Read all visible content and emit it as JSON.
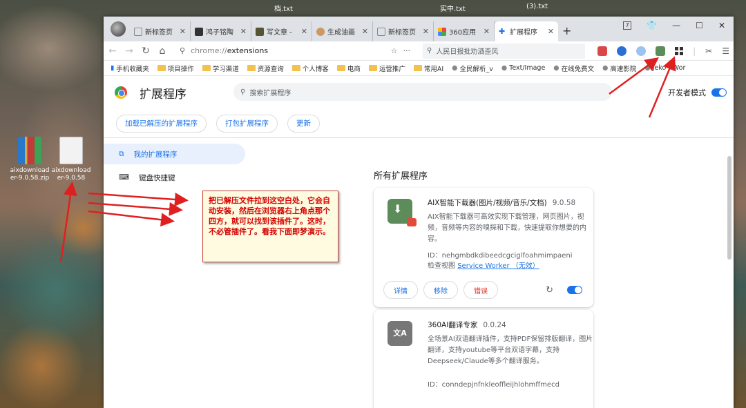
{
  "desktop": {
    "top_texts": [
      "档.txt",
      "实中.txt",
      "(3).txt"
    ],
    "icons": [
      {
        "label": "aixdownload er-9.0.58.zip"
      },
      {
        "label": "aixdownload er-9.0.58"
      }
    ]
  },
  "window": {
    "tabs": [
      {
        "title": "新标签页",
        "favicon": "page-icon"
      },
      {
        "title": "鸿子铭陶",
        "favicon": "photo-icon"
      },
      {
        "title": "写文章 -",
        "favicon": "photo-icon"
      },
      {
        "title": "生成油画",
        "favicon": "portrait-icon"
      },
      {
        "title": "新标签页",
        "favicon": "page-icon"
      },
      {
        "title": "360应用",
        "favicon": "apps-icon"
      },
      {
        "title": "扩展程序",
        "favicon": "puzzle-icon",
        "active": true
      }
    ],
    "new_tab": "+",
    "controls": {
      "badge": "7",
      "minimize": "—",
      "maximize": "☐",
      "close": "✕"
    }
  },
  "toolbar": {
    "url_scheme": "chrome://",
    "url_path": "extensions",
    "search_placeholder": "人民日报批劝酒歪风"
  },
  "bookmarks": [
    {
      "label": "手机收藏夹",
      "type": "mobile"
    },
    {
      "label": "项目操作",
      "type": "folder"
    },
    {
      "label": "学习渠道",
      "type": "folder"
    },
    {
      "label": "资源查询",
      "type": "folder"
    },
    {
      "label": "个人博客",
      "type": "folder"
    },
    {
      "label": "电商",
      "type": "folder"
    },
    {
      "label": "运营推广",
      "type": "folder"
    },
    {
      "label": "常用AI",
      "type": "folder"
    },
    {
      "label": "全民解析_v",
      "type": "site"
    },
    {
      "label": "Text/Image",
      "type": "site"
    },
    {
      "label": "在线免费文",
      "type": "site"
    },
    {
      "label": "高速影院",
      "type": "site"
    },
    {
      "label": "Jeko - Wor",
      "type": "site"
    }
  ],
  "extensions_page": {
    "title": "扩展程序",
    "search_placeholder": "搜索扩展程序",
    "dev_mode_label": "开发者模式",
    "dev_mode_on": true,
    "buttons": {
      "load_unpacked": "加载已解压的扩展程序",
      "pack": "打包扩展程序",
      "update": "更新"
    },
    "sidebar": [
      {
        "label": "我的扩展程序",
        "active": true
      },
      {
        "label": "键盘快捷键",
        "active": false
      }
    ],
    "all_title": "所有扩展程序",
    "cards": [
      {
        "name": "AIX智能下载器(图片/视频/音乐/文档)",
        "version": "9.0.58",
        "desc": "AIX智能下载器可高效实现下载管理，网页图片，视频，音频等内容的嗅探和下载，快速提取你想要的内容。",
        "id": "ID：nehgmbdkdibeedcgciglfoahmimpaeni",
        "inspect_label": "检查视图",
        "inspect_link": "Service Worker （无效）",
        "btn_details": "详情",
        "btn_remove": "移除",
        "btn_errors": "错误",
        "enabled": true
      },
      {
        "name": "360AI翻译专家",
        "version": "0.0.24",
        "desc": "全场景AI双语翻译插件，支持PDF保留排版翻译，图片翻译，支持youtube等平台双语字幕，支持Deepseek/Claude等多个翻译服务。",
        "id": "ID：conndepjnfnkleoffleijhlohmffmecd"
      }
    ]
  },
  "annotation": {
    "text": "把已解压文件拉到这空白处，它会自动安装，然后在浏览器右上角点那个四方，就可以找到该插件了。这时，不必管插件了。看我下面即梦演示。"
  },
  "colors": {
    "accent": "#1a73e8",
    "annotation": "#d40000",
    "arrow": "#e02020"
  }
}
